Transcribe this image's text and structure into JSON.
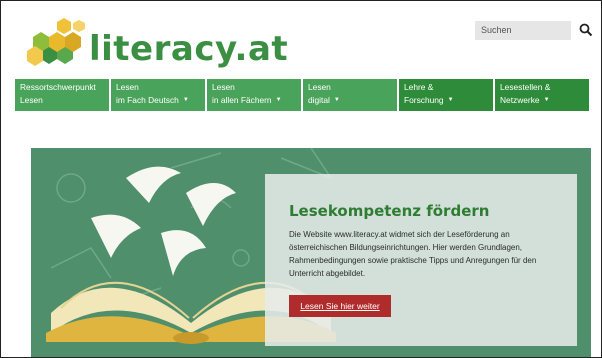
{
  "logo": {
    "text": "literacy.at"
  },
  "search": {
    "placeholder": "Suchen"
  },
  "nav": [
    {
      "line1": "Ressortschwerpunkt",
      "line2": "Lesen",
      "dropdown": false,
      "color": "#4aa35a"
    },
    {
      "line1": "Lesen",
      "line2": "im Fach Deutsch",
      "dropdown": true,
      "color": "#4aa35a"
    },
    {
      "line1": "Lesen",
      "line2": "in allen Fächern",
      "dropdown": true,
      "color": "#4aa35a"
    },
    {
      "line1": "Lesen",
      "line2": "digital",
      "dropdown": true,
      "color": "#4aa35a"
    },
    {
      "line1": "Lehre &",
      "line2": "Forschung",
      "dropdown": true,
      "color": "#2e8b3a"
    },
    {
      "line1": "Lesestellen &",
      "line2": "Netzwerke",
      "dropdown": true,
      "color": "#2e8b3a"
    }
  ],
  "hero": {
    "title": "Lesekompetenz fördern",
    "text": "Die Website www.literacy.at widmet sich der Leseförderung an österreichischen Bildungseinrichtungen. Hier werden Grundlagen, Rahmenbedingungen sowie praktische Tipps und Anregungen für den Unterricht abgebildet.",
    "cta": "Lesen Sie hier weiter"
  },
  "colors": {
    "brand_green": "#3b8f43",
    "chalkboard": "#4f8f6c",
    "cta": "#b02c2c"
  }
}
